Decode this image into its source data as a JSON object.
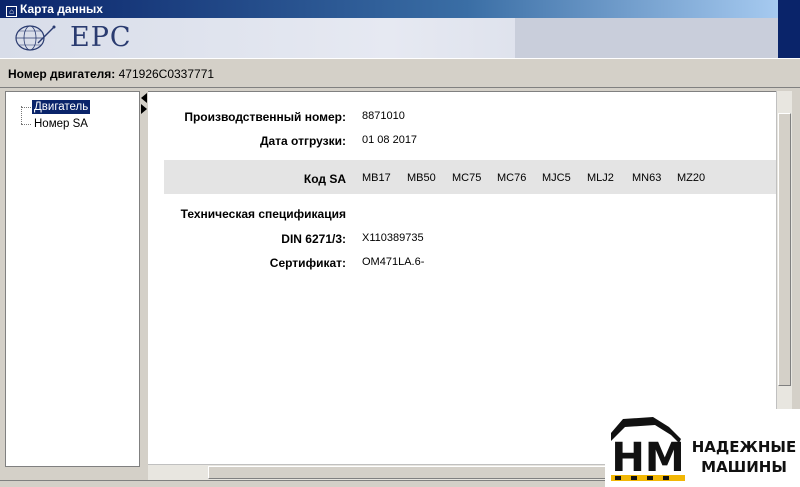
{
  "window": {
    "title": "Карта данных"
  },
  "banner": {
    "app_name": "EPC"
  },
  "engine": {
    "label": "Номер двигателя:",
    "value": "471926C0337771"
  },
  "tree": {
    "items": [
      {
        "label": "Двигатель",
        "selected": true
      },
      {
        "label": "Номер SA",
        "selected": false
      }
    ]
  },
  "details": {
    "production_number": {
      "label": "Производственный номер:",
      "value": "8871010"
    },
    "shipping_date": {
      "label": "Дата отгрузки:",
      "value": "01 08 2017"
    },
    "sa_codes": {
      "label": "Код SA",
      "codes": [
        "MB17",
        "MB50",
        "MC75",
        "MC76",
        "MJC5",
        "MLJ2",
        "MN63",
        "MZ20"
      ]
    },
    "tech_spec_heading": "Техническая спецификация",
    "din": {
      "label": "DIN 6271/3:",
      "value": "X110389735"
    },
    "certificate": {
      "label": "Сертификат:",
      "value": "OM471LA.6-"
    }
  },
  "watermark": {
    "logo_text": "HM",
    "line1": "НАДЕЖНЫЕ",
    "line2": "МАШИНЫ"
  },
  "colors": {
    "titlebar": "#0a246a",
    "selection": "#0a246a",
    "band": "#e4e4e4",
    "watermark_accent": "#f2b705"
  }
}
